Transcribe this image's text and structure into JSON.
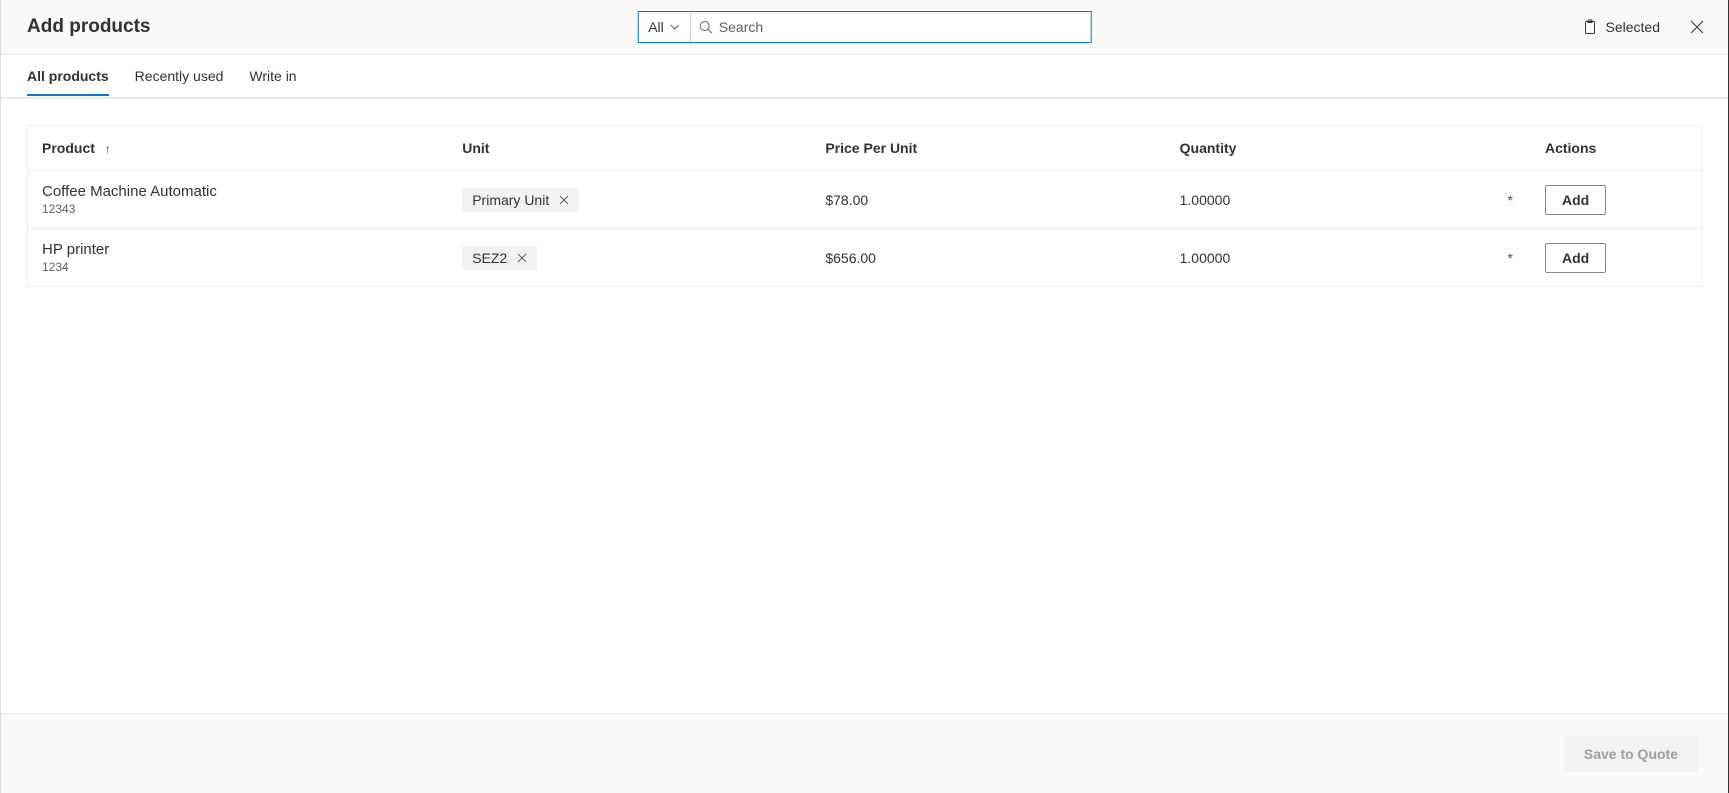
{
  "header": {
    "title": "Add products",
    "filter_label": "All",
    "search_placeholder": "Search",
    "selected_label": "Selected"
  },
  "tabs": [
    {
      "label": "All products",
      "active": true
    },
    {
      "label": "Recently used",
      "active": false
    },
    {
      "label": "Write in",
      "active": false
    }
  ],
  "columns": {
    "product": "Product",
    "unit": "Unit",
    "price": "Price Per Unit",
    "quantity": "Quantity",
    "actions": "Actions"
  },
  "rows": [
    {
      "name": "Coffee Machine Automatic",
      "code": "12343",
      "unit": "Primary Unit",
      "price": "$78.00",
      "quantity": "1.00000",
      "action": "Add"
    },
    {
      "name": "HP printer",
      "code": "1234",
      "unit": "SEZ2",
      "price": "$656.00",
      "quantity": "1.00000",
      "action": "Add"
    }
  ],
  "footer": {
    "save_label": "Save to Quote"
  }
}
